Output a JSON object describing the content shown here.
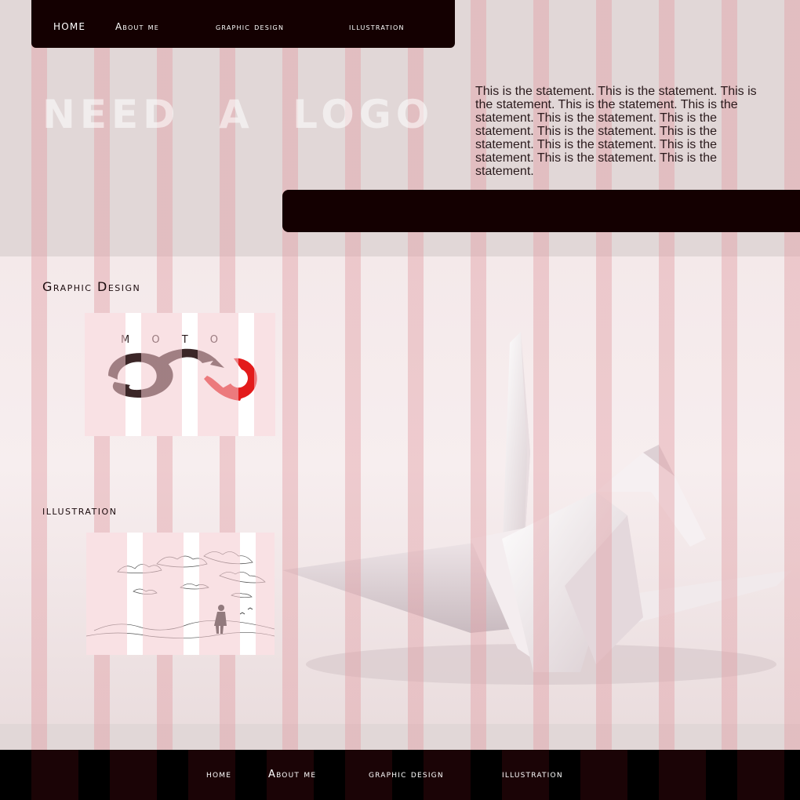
{
  "nav": {
    "home": "HOME",
    "about": "About me",
    "graphic": "graphic design",
    "illustration": "illustration"
  },
  "logo_text": "Need a logo",
  "statement": "This is the statement. This is the statement. This is the statement. This is the statement. This is the statement. This is the statement. This is the statement. This is the statement. This is the statement. This is the statement. This is the statement. This is the statement. This is the statement.",
  "sections": {
    "graphic_design": {
      "heading": "Graphic Design"
    },
    "illustration": {
      "heading": "illustration"
    }
  },
  "moto_logo": {
    "letters": "M O T O"
  },
  "footer": {
    "home": "home",
    "about": "About me",
    "graphic": "graphic design",
    "illustration": "illustration"
  },
  "colors": {
    "nav_bg": "#140001",
    "stripe": "#e2a0a6",
    "accent_red": "#e31b1b",
    "dark_brown": "#3b2627"
  }
}
